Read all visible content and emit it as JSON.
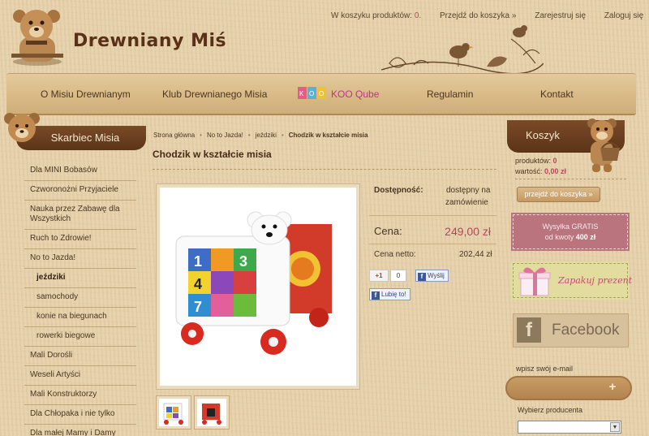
{
  "top_links": {
    "cart_text": "W koszyku produktów:",
    "cart_count": "0.",
    "go_to_cart": "Przejdź do koszyka »",
    "register": "Zarejestruj się",
    "login": "Zaloguj się"
  },
  "logo": {
    "title": "Drewniany Miś"
  },
  "nav": {
    "items": [
      "O Misiu Drewnianym",
      "Klub Drewnianego Misia",
      "KOO Qube",
      "Regulamin",
      "Kontakt"
    ],
    "koo_logo_text": "KOO"
  },
  "sidebar": {
    "title": "Skarbiec Misia",
    "items": [
      "Dla MINI Bobasów",
      "Czworonożni Przyjaciele",
      "Nauka przez Zabawę dla Wszystkich",
      "Ruch to Zdrowie!",
      "No to Jazda!",
      "jeździki",
      "samochody",
      "konie na biegunach",
      "rowerki biegowe",
      "Mali Dorośli",
      "Weseli Artyści",
      "Mali Konstruktorzy",
      "Dla Chłopaka i nie tylko",
      "Dla małej Mamy i Damy"
    ]
  },
  "breadcrumb": [
    "Strona główna",
    "No to Jazda!",
    "jeździki",
    "Chodzik w kształcie misia"
  ],
  "product": {
    "title": "Chodzik w kształcie misia",
    "availability_label": "Dostępność:",
    "availability_value_1": "dostępny na",
    "availability_value_2": "zamówienie",
    "price_label": "Cena:",
    "price_value": "249,00 zł",
    "net_label": "Cena netto:",
    "net_value": "202,44 zł",
    "gplus_label": "+1",
    "gplus_count": "0",
    "send_label": "Wyślij",
    "like_label": "Lubię to!",
    "cube_digits": [
      "1",
      "3",
      "4",
      "7"
    ]
  },
  "cart": {
    "title": "Koszyk",
    "products_label": "produktów:",
    "products_value": "0",
    "value_label": "wartość:",
    "value_value": "0,00 zł",
    "button": "przejdź do koszyka »"
  },
  "promos": {
    "shipping_line1": "Wysyłka GRATIS",
    "shipping_line2_prefix": "od kwoty",
    "shipping_amount": "400 zł",
    "gift_text": "Zapakuj prezent",
    "facebook": "Facebook"
  },
  "newsletter": {
    "label": "wpisz swój e-mail",
    "placeholder": ""
  },
  "producer": {
    "label": "Wybierz producenta",
    "selected": ""
  },
  "colors": {
    "accent": "#b5475a",
    "brown": "#5b3418",
    "beige": "#e6d2ac"
  }
}
